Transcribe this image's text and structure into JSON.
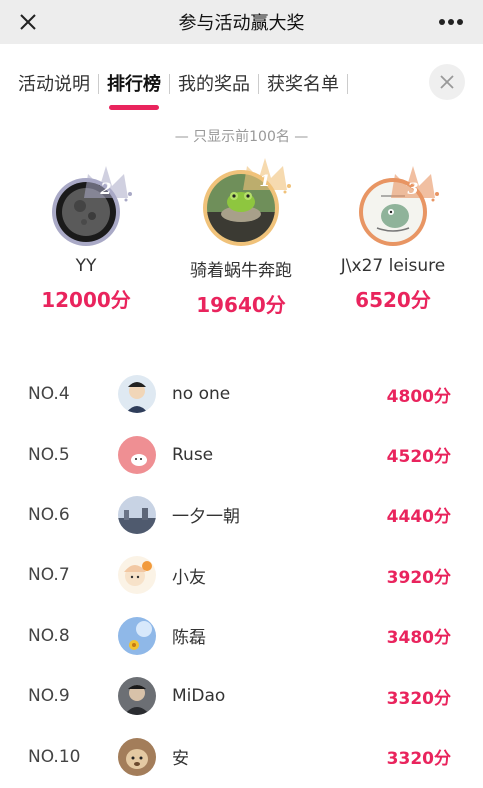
{
  "topbar": {
    "title": "参与活动赢大奖",
    "close_icon": "close-icon",
    "more_icon": "more-icon"
  },
  "tabs": [
    {
      "label": "活动说明",
      "active": false
    },
    {
      "label": "排行榜",
      "active": true
    },
    {
      "label": "我的奖品",
      "active": false
    },
    {
      "label": "获奖名单",
      "active": false
    }
  ],
  "notice": "— 只显示前100名 —",
  "colors": {
    "accent": "#e9245d",
    "silver": "#a9a9c6",
    "gold": "#f0c27a",
    "bronze": "#e89563"
  },
  "top3": [
    {
      "rank": "2",
      "name": "YY",
      "score": "12000分"
    },
    {
      "rank": "1",
      "name": "骑着蜗牛奔跑",
      "score": "19640分"
    },
    {
      "rank": "3",
      "name": "J\\x27 leisure",
      "score": "6520分"
    }
  ],
  "rows": [
    {
      "no": "NO.4",
      "name": "no one",
      "score": "4800分"
    },
    {
      "no": "NO.5",
      "name": "Ruse",
      "score": "4520分"
    },
    {
      "no": "NO.6",
      "name": "一夕一朝",
      "score": "4440分"
    },
    {
      "no": "NO.7",
      "name": "小友",
      "score": "3920分"
    },
    {
      "no": "NO.8",
      "name": "陈磊",
      "score": "3480分"
    },
    {
      "no": "NO.9",
      "name": "MiDao",
      "score": "3320分"
    },
    {
      "no": "NO.10",
      "name": "安",
      "score": "3320分"
    }
  ]
}
